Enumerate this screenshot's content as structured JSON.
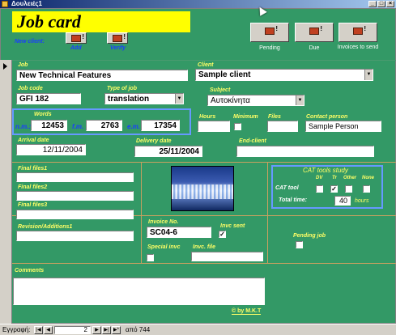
{
  "window": {
    "title": "Δουλειές1",
    "min": "_",
    "max": "□",
    "close": "×"
  },
  "header": {
    "title": "Job card",
    "new_client_label": "New client:",
    "add_label": "Add",
    "verify_label": "Verify",
    "pending_label": "Pending",
    "due_label": "Due",
    "invoices_label": "Invoices to send"
  },
  "job": {
    "label": "Job",
    "value": "New Technical Features"
  },
  "client": {
    "label": "Client",
    "value": "Sample client"
  },
  "job_code": {
    "label": "Job code",
    "value": "GFI 182"
  },
  "type_of_job": {
    "label": "Type of job",
    "value": "translation"
  },
  "subject": {
    "label": "Subject",
    "value": "Αυτοκίνητα"
  },
  "words": {
    "label": "Words",
    "nm_label": "n.m.:",
    "nm_value": "12453",
    "fm_label": "f.m.",
    "fm_value": "2763",
    "em_label": "e.m.",
    "em_value": "17354"
  },
  "hours": {
    "label": "Hours",
    "value": ""
  },
  "minimum": {
    "label": "Minimum"
  },
  "files": {
    "label": "Files",
    "value": ""
  },
  "contact_person": {
    "label": "Contact person",
    "value": "Sample Person"
  },
  "arrival_date": {
    "label": "Arrival date",
    "value": "12/11/2004"
  },
  "delivery_date": {
    "label": "Delivery date",
    "value": "25/11/2004"
  },
  "end_client": {
    "label": "End-client",
    "value": ""
  },
  "final_files1": {
    "label": "Final files1"
  },
  "final_files2": {
    "label": "Final files2"
  },
  "final_files3": {
    "label": "Final files3"
  },
  "revision": {
    "label": "Revision/Additions1"
  },
  "cat": {
    "title": "CAT tools study",
    "col_dv": "DV",
    "col_tr": "Tr",
    "col_other": "Other",
    "col_none": "None",
    "tool_label": "CAT tool",
    "tr_checked": "✓",
    "total_time_label": "Total time:",
    "total_time_value": "40",
    "hours_label": "hours"
  },
  "invoice": {
    "label": "Invoice No.",
    "value": "SC04-6"
  },
  "invc_sent": {
    "label": "Invc sent",
    "checked": "✓"
  },
  "special_invc": {
    "label": "Special invc"
  },
  "invc_file": {
    "label": "Invc. file"
  },
  "pending_job": {
    "label": "Pending job"
  },
  "comments": {
    "label": "Comments"
  },
  "credit": "© by M.K.T",
  "nav": {
    "record_label": "Εγγραφή:",
    "current": "2",
    "of_label": "από 744"
  }
}
